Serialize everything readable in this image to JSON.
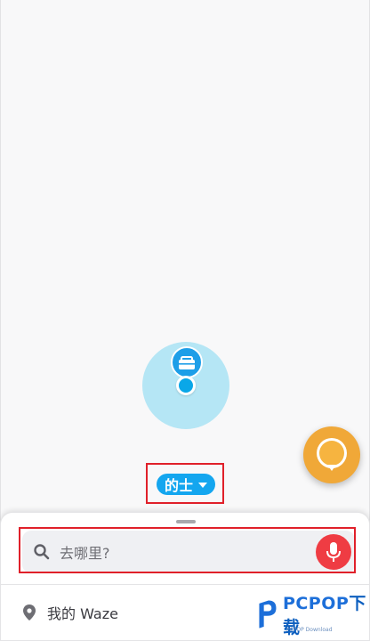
{
  "map": {
    "vehicle_selector": {
      "label": "的士"
    }
  },
  "bottom_sheet": {
    "search": {
      "placeholder": "去哪里?"
    },
    "my_waze": {
      "label": "我的 Waze"
    }
  },
  "watermark": {
    "brand": "PCPOP",
    "suffix": "下载",
    "sub": "PCPOP Download"
  },
  "colors": {
    "accent_blue": "#14a6ef",
    "mic_red": "#ef3c43",
    "report_orange": "#f0a838",
    "highlight_red": "#e0202a"
  },
  "icons": {
    "search": "search-icon",
    "mic": "microphone-icon",
    "pin": "location-pin-icon",
    "work": "briefcase-icon",
    "report": "report-bubble-icon"
  }
}
